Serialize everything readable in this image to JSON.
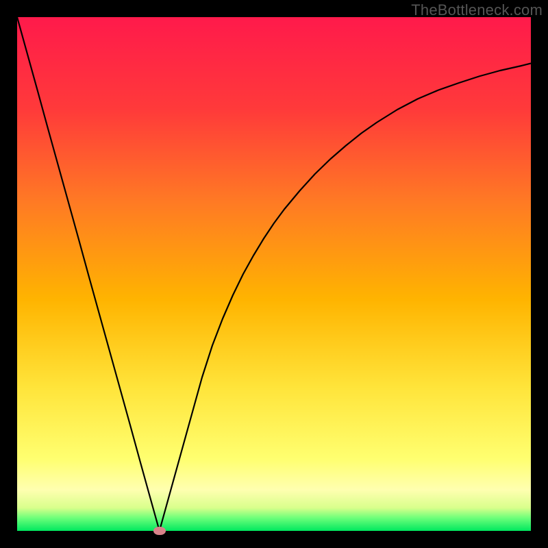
{
  "watermark": "TheBottleneck.com",
  "colors": {
    "top": "#ff1a4b",
    "upper_mid": "#ff5a2a",
    "mid": "#ffb400",
    "lower_mid": "#ffe43a",
    "pale_yellow": "#ffff9e",
    "green": "#00e85f",
    "curve": "#000000",
    "frame_bg": "#000000",
    "marker": "#d9838a"
  },
  "chart_data": {
    "type": "line",
    "title": "",
    "xlabel": "",
    "ylabel": "",
    "xlim": [
      0,
      1
    ],
    "ylim": [
      0,
      1
    ],
    "x": [
      0.0,
      0.02,
      0.04,
      0.06,
      0.08,
      0.1,
      0.12,
      0.14,
      0.16,
      0.18,
      0.2,
      0.22,
      0.24,
      0.26,
      0.277,
      0.3,
      0.32,
      0.34,
      0.36,
      0.38,
      0.4,
      0.42,
      0.44,
      0.46,
      0.48,
      0.5,
      0.52,
      0.55,
      0.58,
      0.61,
      0.64,
      0.67,
      0.7,
      0.74,
      0.78,
      0.82,
      0.86,
      0.9,
      0.94,
      0.98,
      1.0
    ],
    "y": [
      1.0,
      0.928,
      0.856,
      0.783,
      0.711,
      0.639,
      0.567,
      0.494,
      0.422,
      0.35,
      0.278,
      0.206,
      0.133,
      0.061,
      0.0,
      0.083,
      0.155,
      0.227,
      0.299,
      0.361,
      0.413,
      0.459,
      0.5,
      0.536,
      0.569,
      0.599,
      0.626,
      0.662,
      0.695,
      0.724,
      0.75,
      0.774,
      0.795,
      0.82,
      0.841,
      0.858,
      0.872,
      0.885,
      0.896,
      0.905,
      0.91
    ],
    "marker": {
      "x": 0.277,
      "y": 0.0
    },
    "gradient_stops": [
      {
        "offset": 0.0,
        "color": "#ff1a4b"
      },
      {
        "offset": 0.18,
        "color": "#ff3a3a"
      },
      {
        "offset": 0.36,
        "color": "#ff7a24"
      },
      {
        "offset": 0.55,
        "color": "#ffb400"
      },
      {
        "offset": 0.72,
        "color": "#ffe43a"
      },
      {
        "offset": 0.86,
        "color": "#ffff70"
      },
      {
        "offset": 0.92,
        "color": "#ffffb0"
      },
      {
        "offset": 0.955,
        "color": "#d9ff8c"
      },
      {
        "offset": 0.975,
        "color": "#6cff7a"
      },
      {
        "offset": 1.0,
        "color": "#00e85f"
      }
    ]
  }
}
